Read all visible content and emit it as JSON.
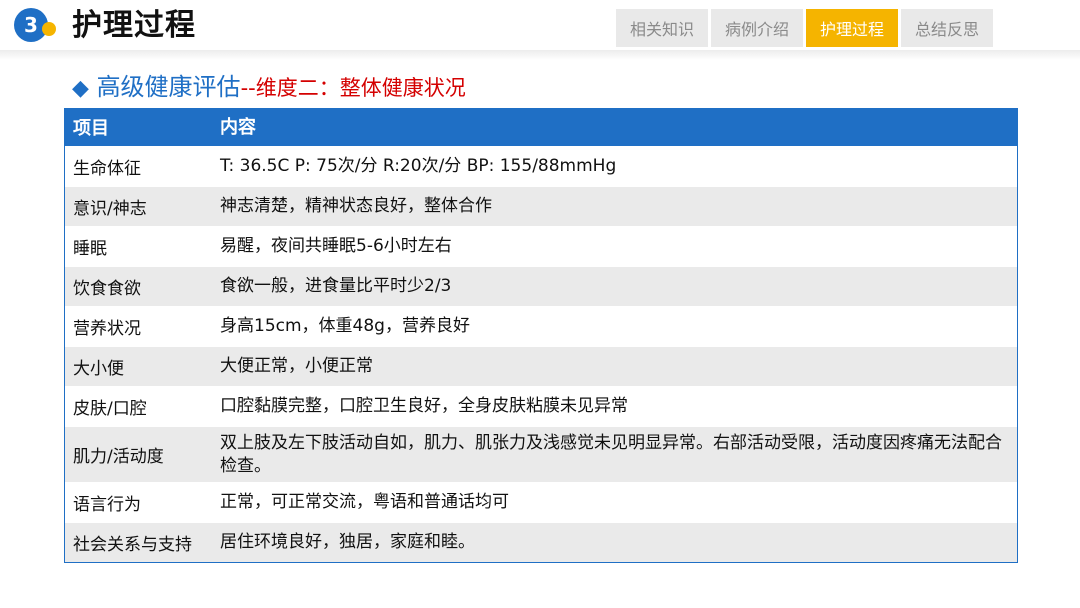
{
  "header": {
    "badge_number": "3",
    "title": "护理过程",
    "tabs": [
      {
        "label": "相关知识",
        "active": false
      },
      {
        "label": "病例介绍",
        "active": false
      },
      {
        "label": "护理过程",
        "active": true
      },
      {
        "label": "总结反思",
        "active": false
      }
    ]
  },
  "section": {
    "bullet": "◆",
    "title_main": "高级健康评估",
    "title_sub": "--维度二：整体健康状况"
  },
  "table": {
    "headers": [
      "项目",
      "内容"
    ],
    "rows": [
      {
        "item": "生命体征",
        "content": "T: 36.5C P: 75次/分 R:20次/分 BP: 155/88mmHg"
      },
      {
        "item": "意识/神志",
        "content": "神志清楚，精神状态良好，整体合作"
      },
      {
        "item": "睡眠",
        "content": "易醒，夜间共睡眠5-6小时左右"
      },
      {
        "item": "饮食食欲",
        "content": "食欲一般，进食量比平时少2/3"
      },
      {
        "item": "营养状况",
        "content": "身高15cm，体重48g，营养良好"
      },
      {
        "item": "大小便",
        "content": "大便正常，小便正常"
      },
      {
        "item": "皮肤/口腔",
        "content": "口腔黏膜完整，口腔卫生良好，全身皮肤粘膜未见异常"
      },
      {
        "item": "肌力/活动度",
        "content": "双上肢及左下肢活动自如，肌力、肌张力及浅感觉未见明显异常。右部活动受限，活动度因疼痛无法配合检查。"
      },
      {
        "item": "语言行为",
        "content": "正常，可正常交流，粤语和普通话均可"
      },
      {
        "item": "社会关系与支持",
        "content": "居住环境良好，独居，家庭和睦。"
      }
    ]
  },
  "colors": {
    "accent_blue": "#1f6fc5",
    "accent_gold": "#f5b400",
    "title_red": "#d40000"
  }
}
